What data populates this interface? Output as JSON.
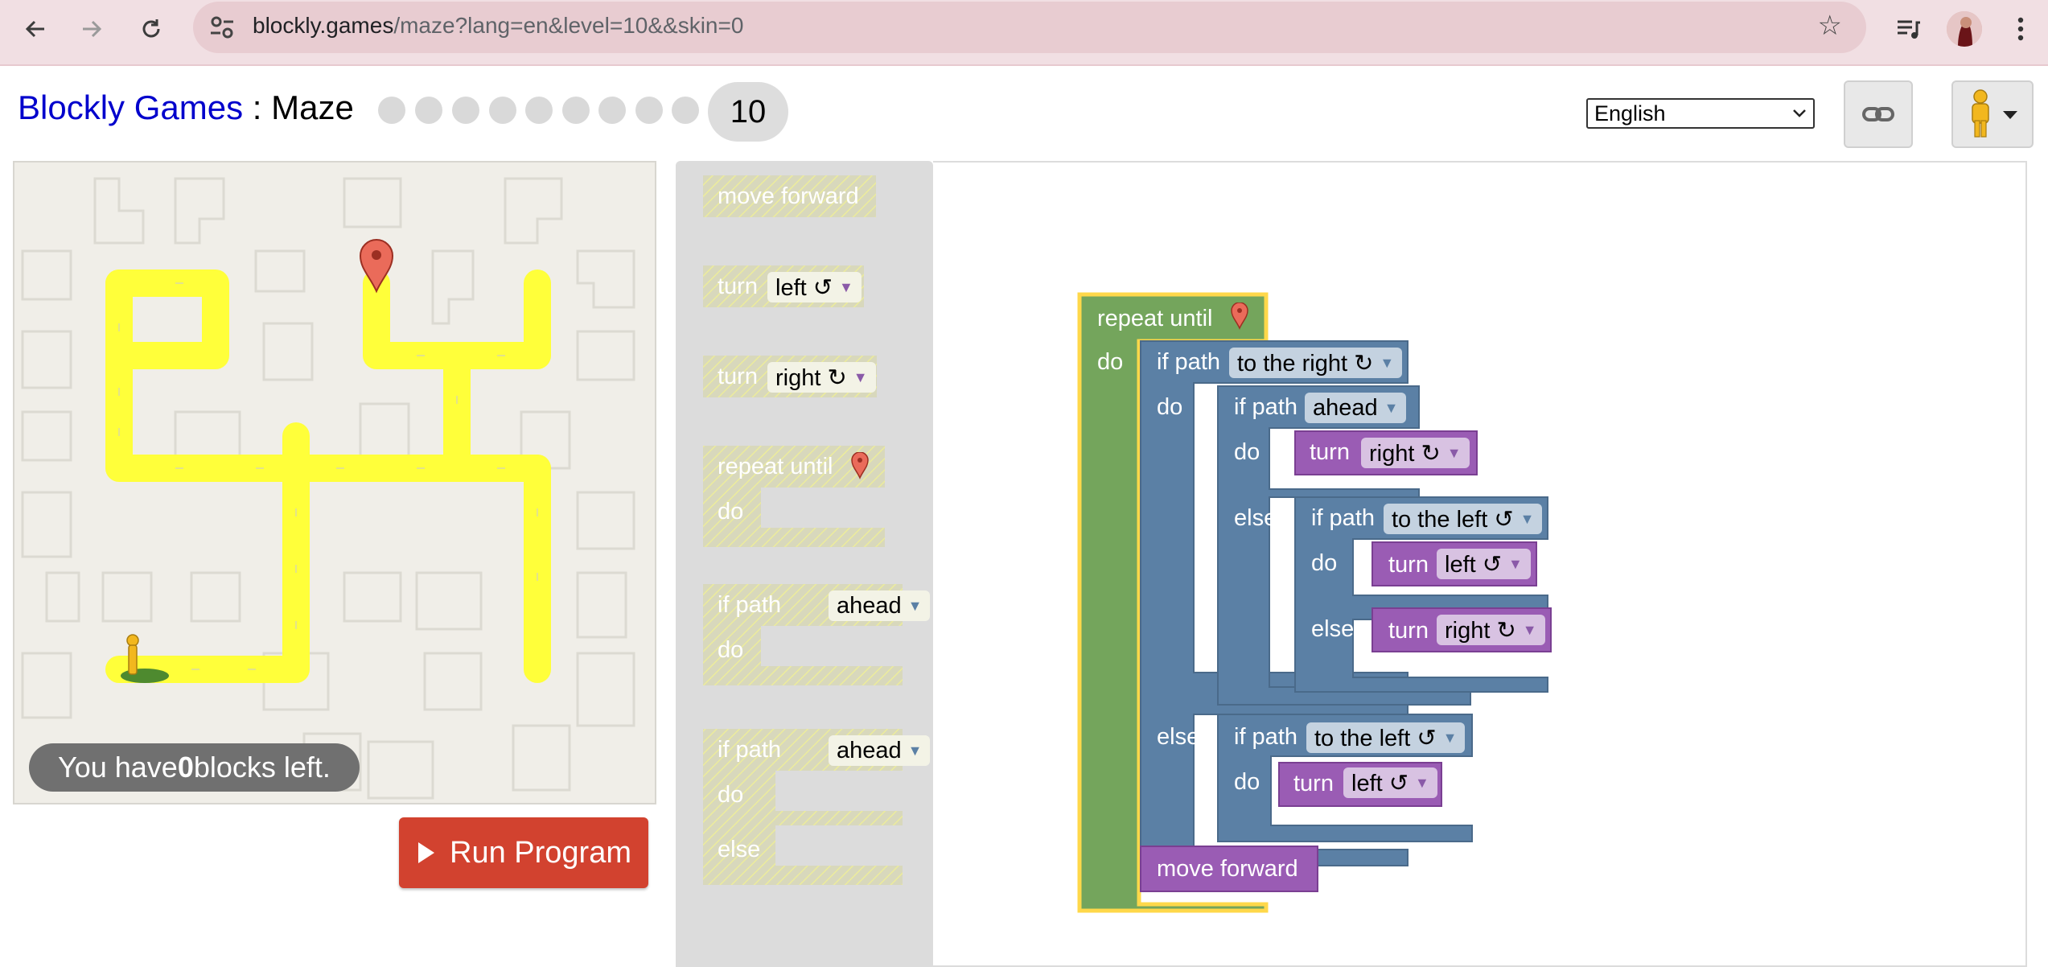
{
  "browser": {
    "url_host": "blockly.games",
    "url_rest": "/maze?lang=en&level=10&&skin=0"
  },
  "header": {
    "brand": "Blockly Games",
    "separator": " : ",
    "game": "Maze",
    "level": "10",
    "language": "English"
  },
  "maze": {
    "blocks_left_prefix": "You have ",
    "blocks_left_count": "0",
    "blocks_left_suffix": " blocks left.",
    "run_label": "Run Program"
  },
  "toolbox": {
    "move_forward": "move forward",
    "turn": "turn",
    "left": "left ↺",
    "right": "right ↻",
    "repeat_until": "repeat until",
    "do": "do",
    "if_path": "if path",
    "ahead": "ahead",
    "else": "else"
  },
  "program": {
    "repeat_until": "repeat until",
    "do": "do",
    "else": "else",
    "if_path": "if path",
    "to_the_right": "to the right ↻",
    "to_the_left": "to the left ↺",
    "ahead": "ahead",
    "turn": "turn",
    "right": "right ↻",
    "left": "left ↺",
    "move_forward": "move forward"
  },
  "colors": {
    "loop_green": "#74a55c",
    "logic_blue": "#5b80a5",
    "move_purple": "#9a5cb4",
    "path_yellow": "#ffff3a",
    "run_red": "#d2422f"
  }
}
